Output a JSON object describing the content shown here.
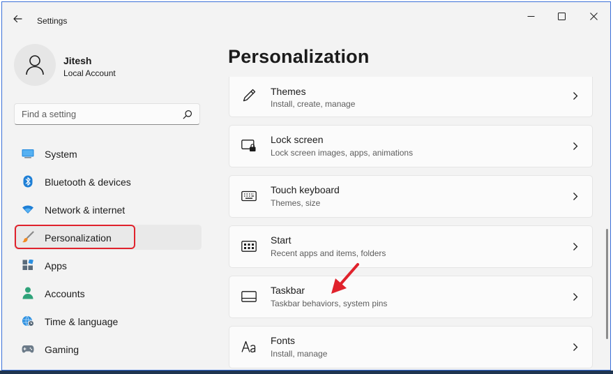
{
  "window": {
    "title": "Settings"
  },
  "profile": {
    "name": "Jitesh",
    "account_type": "Local Account"
  },
  "search": {
    "placeholder": "Find a setting"
  },
  "sidebar": {
    "items": [
      {
        "label": "System",
        "icon": "monitor-icon"
      },
      {
        "label": "Bluetooth & devices",
        "icon": "bluetooth-icon"
      },
      {
        "label": "Network & internet",
        "icon": "wifi-icon"
      },
      {
        "label": "Personalization",
        "icon": "brush-icon",
        "active": true
      },
      {
        "label": "Apps",
        "icon": "apps-icon"
      },
      {
        "label": "Accounts",
        "icon": "person-icon"
      },
      {
        "label": "Time & language",
        "icon": "globe-clock-icon"
      },
      {
        "label": "Gaming",
        "icon": "controller-icon"
      }
    ]
  },
  "main": {
    "title": "Personalization",
    "cards": [
      {
        "title": "Themes",
        "subtitle": "Install, create, manage",
        "icon": "pen-icon"
      },
      {
        "title": "Lock screen",
        "subtitle": "Lock screen images, apps, animations",
        "icon": "lock-screen-icon"
      },
      {
        "title": "Touch keyboard",
        "subtitle": "Themes, size",
        "icon": "keyboard-icon"
      },
      {
        "title": "Start",
        "subtitle": "Recent apps and items, folders",
        "icon": "start-icon"
      },
      {
        "title": "Taskbar",
        "subtitle": "Taskbar behaviors, system pins",
        "icon": "taskbar-icon"
      },
      {
        "title": "Fonts",
        "subtitle": "Install, manage",
        "icon": "font-icon"
      }
    ]
  },
  "colors": {
    "accent": "#0067c0",
    "highlight": "#e0222c",
    "sidebar_bg": "#f3f3f3",
    "card_bg": "#fbfbfb"
  }
}
